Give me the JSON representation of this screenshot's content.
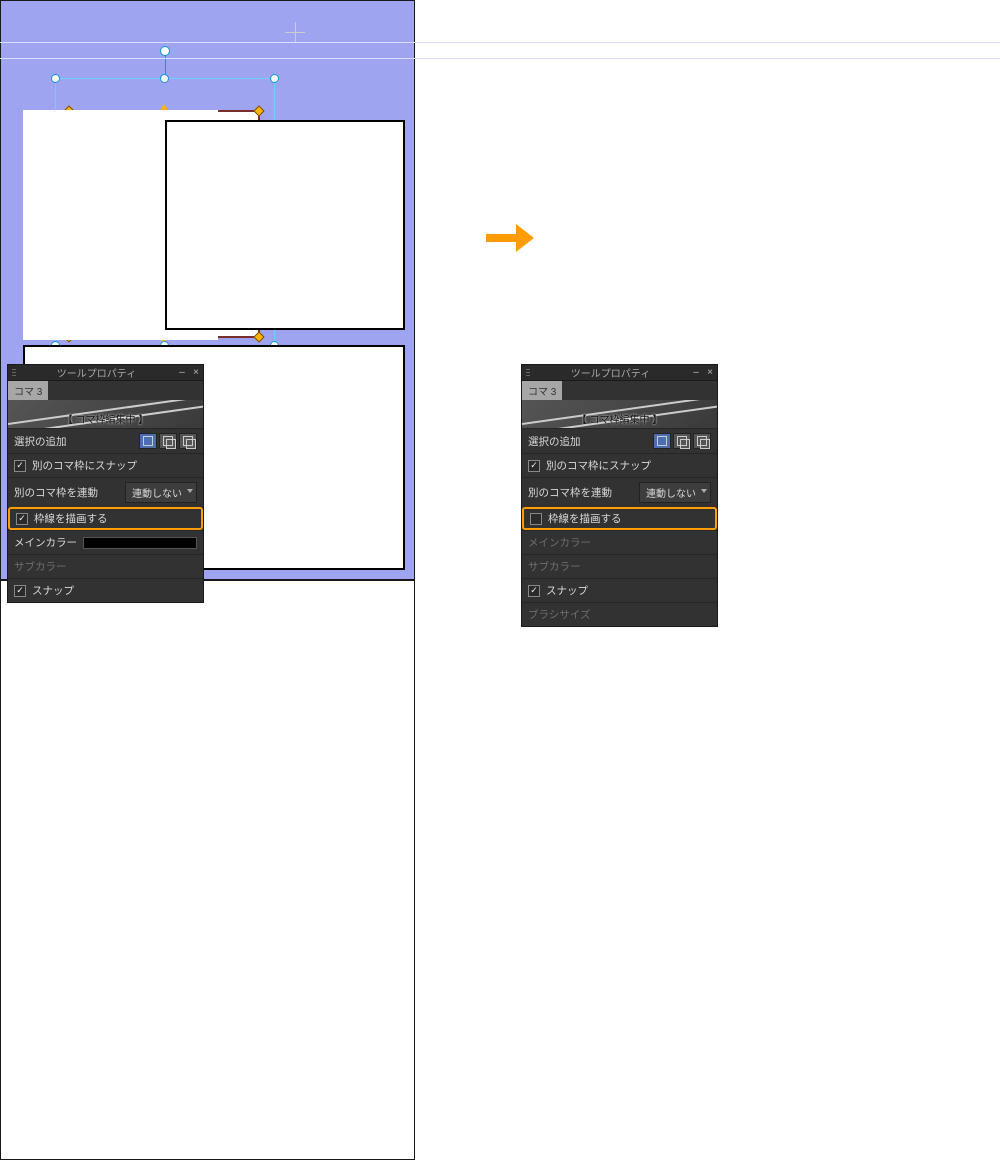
{
  "arrow": {
    "semantic": "result-arrow"
  },
  "left_canvas": {
    "semantic": "canvas-before"
  },
  "right_canvas": {
    "semantic": "canvas-after"
  },
  "tool_panel": {
    "title": "ツールプロパティ",
    "tab_label": "コマ 3",
    "preview_label": "【 コマ枠編集中 】",
    "rows": {
      "selection_add": {
        "label": "選択の追加"
      },
      "snap_other": {
        "label": "別のコマ枠にスナップ",
        "checked": true
      },
      "link_other": {
        "label": "別のコマ枠を連動",
        "value": "連動しない"
      },
      "draw_border": {
        "label": "枠線を描画する"
      },
      "main_color": {
        "label": "メインカラー"
      },
      "sub_color": {
        "label": "サブカラー"
      },
      "brush_size": {
        "label": "ブラシサイズ"
      },
      "snap": {
        "label": "スナップ",
        "checked": true
      }
    }
  },
  "panel_left": {
    "draw_border_checked": true
  },
  "panel_right": {
    "draw_border_checked": false
  }
}
